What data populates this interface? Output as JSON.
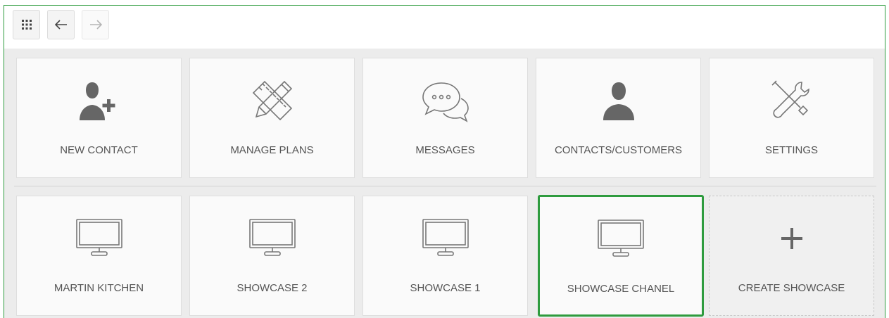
{
  "toolbar": {
    "apps_icon": "grid-icon",
    "back_icon": "arrow-left-icon",
    "forward_icon": "arrow-right-icon"
  },
  "tiles_row1": [
    {
      "label": "NEW CONTACT",
      "icon": "add-user-icon"
    },
    {
      "label": "MANAGE PLANS",
      "icon": "pencil-ruler-icon"
    },
    {
      "label": "MESSAGES",
      "icon": "chat-bubbles-icon"
    },
    {
      "label": "CONTACTS/CUSTOMERS",
      "icon": "user-icon"
    },
    {
      "label": "SETTINGS",
      "icon": "tools-icon"
    }
  ],
  "tiles_row2": [
    {
      "label": "MARTIN KITCHEN",
      "icon": "monitor-icon"
    },
    {
      "label": "SHOWCASE 2",
      "icon": "monitor-icon"
    },
    {
      "label": "SHOWCASE 1",
      "icon": "monitor-icon"
    },
    {
      "label": "SHOWCASE CHANEL",
      "icon": "monitor-icon",
      "selected": true
    },
    {
      "label": "CREATE SHOWCASE",
      "icon": "plus-icon"
    }
  ],
  "colors": {
    "accent": "#2e9b3e",
    "icon": "#666666",
    "label": "#555555"
  }
}
